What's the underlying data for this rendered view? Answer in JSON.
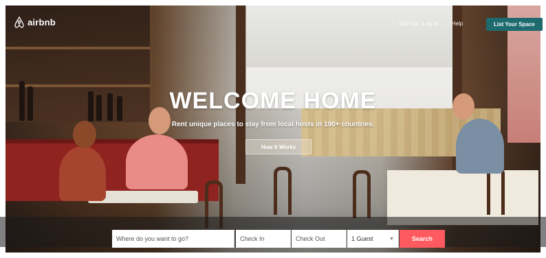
{
  "brand": {
    "name": "airbnb",
    "logo_icon": "airbnb-belo-icon"
  },
  "nav": {
    "sign_up": "Sign Up",
    "log_in": "Log In",
    "help": "Help",
    "list_space": "List Your Space"
  },
  "hero": {
    "headline": "WELCOME HOME",
    "subheadline": "Rent unique places to stay from local hosts in 190+ countries.",
    "how_it_works": "How It Works"
  },
  "search": {
    "where_placeholder": "Where do you want to go?",
    "check_in_placeholder": "Check In",
    "check_out_placeholder": "Check Out",
    "guests_value": "1 Guest",
    "search_label": "Search"
  },
  "colors": {
    "accent": "#ff5a5f",
    "list_button": "#1d6a6f"
  }
}
